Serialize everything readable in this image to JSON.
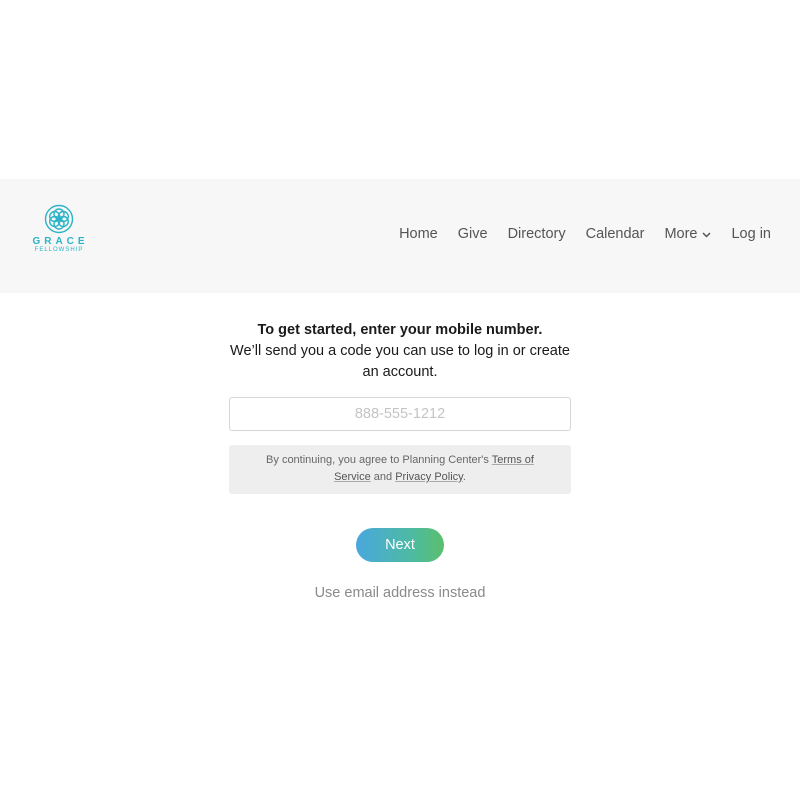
{
  "header": {
    "logo": {
      "name": "GRACE",
      "sub": "FELLOWSHIP",
      "tagline": "",
      "icon": "flower-of-life-icon",
      "color": "#2bb3c8"
    },
    "nav": {
      "home": "Home",
      "give": "Give",
      "directory": "Directory",
      "calendar": "Calendar",
      "more": "More",
      "login": "Log in"
    }
  },
  "main": {
    "heading": "To get started, enter your mobile number.",
    "subheading": "We’ll send you a code you can use to log in or create an account.",
    "phone_placeholder": "888-555-1212",
    "phone_value": "",
    "terms": {
      "prefix": "By continuing, you agree to Planning Center's ",
      "terms_link": "Terms of Service",
      "middle": " and ",
      "privacy_link": "Privacy Policy",
      "suffix": "."
    },
    "next_label": "Next",
    "alt_label": "Use email address instead"
  },
  "colors": {
    "header_bg": "#f7f7f7",
    "button_gradient_start": "#4aa7de",
    "button_gradient_end": "#5bbf6c",
    "terms_bg": "#eeeeee"
  }
}
